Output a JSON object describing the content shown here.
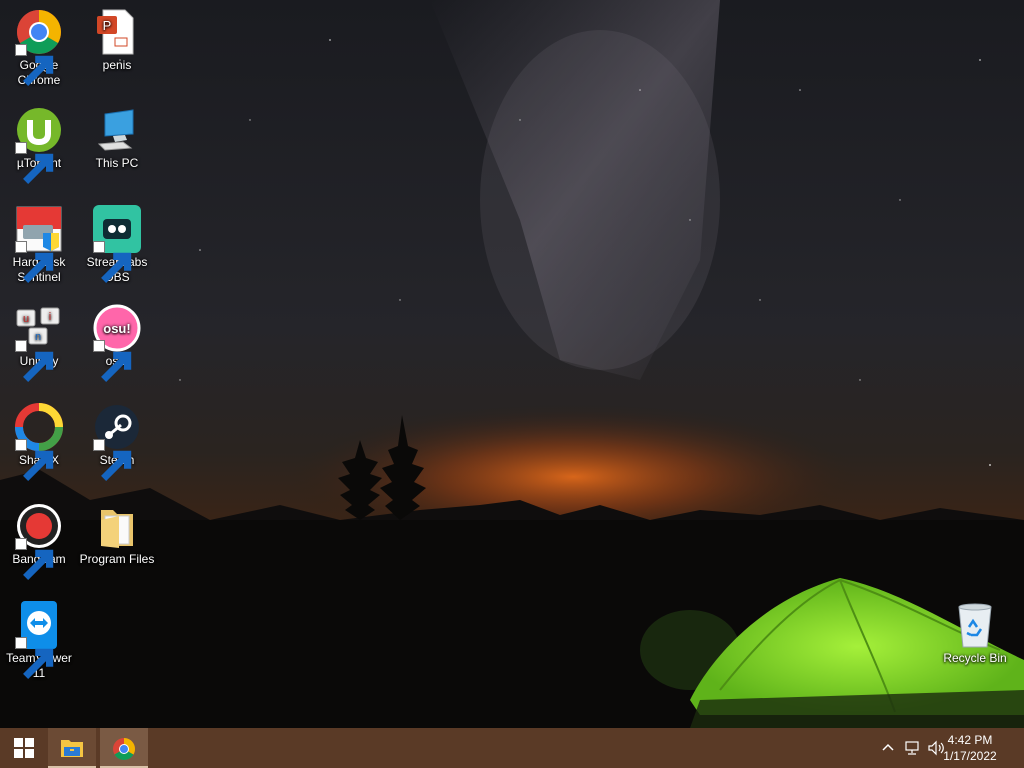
{
  "desktop": {
    "icons": [
      {
        "id": "google-chrome",
        "label_lines": [
          "Google",
          "Chrome"
        ],
        "icon": "chrome-icon",
        "shortcut": true
      },
      {
        "id": "penis",
        "label_lines": [
          "penis"
        ],
        "icon": "powerpoint-file-icon",
        "shortcut": false
      },
      {
        "id": "utorrent",
        "label_lines": [
          "µTorrent"
        ],
        "icon": "utorrent-icon",
        "shortcut": true
      },
      {
        "id": "this-pc",
        "label_lines": [
          "This PC"
        ],
        "icon": "computer-icon",
        "shortcut": false
      },
      {
        "id": "hard-disk-sentinel",
        "label_lines": [
          "Hard Disk",
          "Sentinel"
        ],
        "icon": "hard-disk-sentinel-icon",
        "shortcut": true
      },
      {
        "id": "streamlabs-obs",
        "label_lines": [
          "Streamlabs",
          "OBS"
        ],
        "icon": "streamlabs-icon",
        "shortcut": true
      },
      {
        "id": "unikey",
        "label_lines": [
          "UniKey"
        ],
        "icon": "unikey-icon",
        "shortcut": true
      },
      {
        "id": "osu",
        "label_lines": [
          "osu!"
        ],
        "icon": "osu-icon",
        "shortcut": true
      },
      {
        "id": "sharex",
        "label_lines": [
          "ShareX"
        ],
        "icon": "sharex-icon",
        "shortcut": true
      },
      {
        "id": "steam",
        "label_lines": [
          "Steam"
        ],
        "icon": "steam-icon",
        "shortcut": true
      },
      {
        "id": "bandicam",
        "label_lines": [
          "Bandicam"
        ],
        "icon": "bandicam-icon",
        "shortcut": true
      },
      {
        "id": "program-files",
        "label_lines": [
          "Program Files"
        ],
        "icon": "folder-icon",
        "shortcut": false
      },
      {
        "id": "teamviewer",
        "label_lines": [
          "TeamViewer",
          "11"
        ],
        "icon": "teamviewer-icon",
        "shortcut": true
      },
      {
        "id": "recycle-bin",
        "label_lines": [
          "Recycle Bin"
        ],
        "icon": "recycle-bin-icon",
        "shortcut": false
      }
    ]
  },
  "taskbar": {
    "start_icon": "windows-logo-icon",
    "pinned": [
      {
        "name": "file-explorer",
        "icon": "folder-icon"
      },
      {
        "name": "google-chrome",
        "icon": "chrome-icon"
      }
    ],
    "tray": [
      "chevron-up-icon",
      "network-icon",
      "volume-icon"
    ],
    "clock": {
      "time": "4:42 PM",
      "date": "1/17/2022"
    }
  },
  "colors": {
    "taskbar": "#5a3a26",
    "tent": "#7cd62a",
    "horizon_glow": "#e06a1a"
  }
}
